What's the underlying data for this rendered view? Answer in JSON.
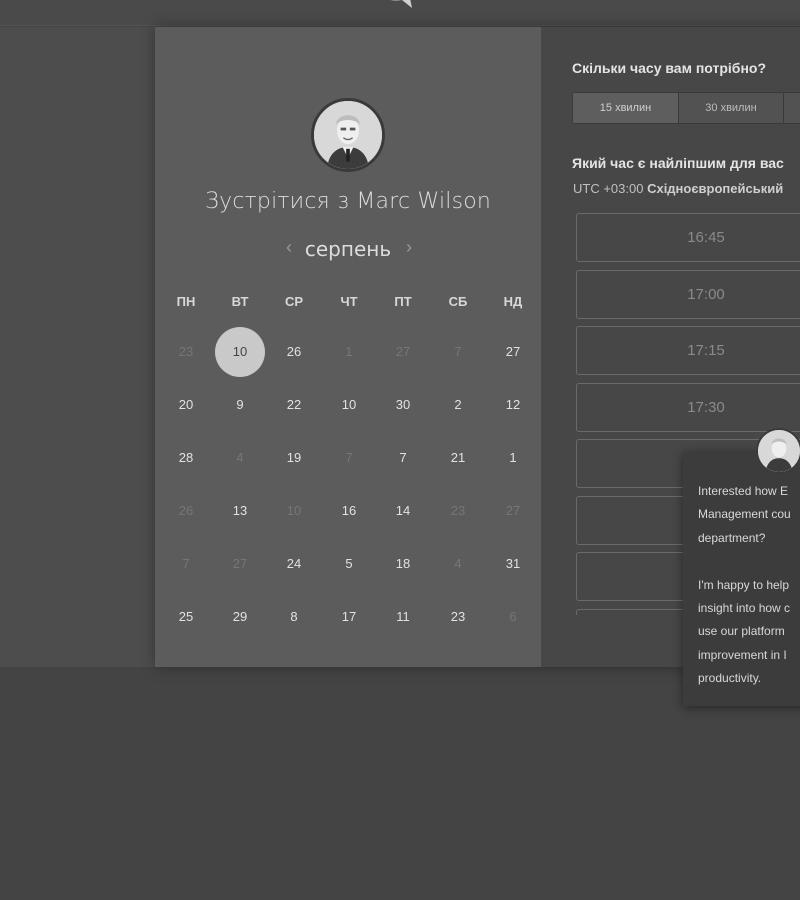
{
  "booking": {
    "meet_title": "Зустрітися з Marc Wilson",
    "month": "серпень",
    "nav_prev": "‹",
    "nav_next": "›"
  },
  "calendar": {
    "weekdays": [
      "ПН",
      "ВТ",
      "СР",
      "ЧТ",
      "ПТ",
      "СБ",
      "НД"
    ],
    "weeks": [
      [
        {
          "d": "23",
          "m": true
        },
        {
          "d": "10",
          "sel": true
        },
        {
          "d": "26"
        },
        {
          "d": "1",
          "m": true
        },
        {
          "d": "27",
          "m": true
        },
        {
          "d": "7",
          "m": true
        },
        {
          "d": "27"
        }
      ],
      [
        {
          "d": "20"
        },
        {
          "d": "9"
        },
        {
          "d": "22"
        },
        {
          "d": "10"
        },
        {
          "d": "30"
        },
        {
          "d": "2"
        },
        {
          "d": "12"
        }
      ],
      [
        {
          "d": "28"
        },
        {
          "d": "4",
          "m": true
        },
        {
          "d": "19"
        },
        {
          "d": "7",
          "m": true
        },
        {
          "d": "7"
        },
        {
          "d": "21"
        },
        {
          "d": "1"
        }
      ],
      [
        {
          "d": "26",
          "m": true
        },
        {
          "d": "13"
        },
        {
          "d": "10",
          "m": true
        },
        {
          "d": "16"
        },
        {
          "d": "14"
        },
        {
          "d": "23",
          "m": true
        },
        {
          "d": "27",
          "m": true
        }
      ],
      [
        {
          "d": "7",
          "m": true
        },
        {
          "d": "27",
          "m": true
        },
        {
          "d": "24"
        },
        {
          "d": "5"
        },
        {
          "d": "18"
        },
        {
          "d": "4",
          "m": true
        },
        {
          "d": "31"
        }
      ],
      [
        {
          "d": "25"
        },
        {
          "d": "29"
        },
        {
          "d": "8"
        },
        {
          "d": "17"
        },
        {
          "d": "11"
        },
        {
          "d": "23"
        },
        {
          "d": "6",
          "m": true
        }
      ]
    ]
  },
  "scheduler": {
    "duration_question": "Скільки часу вам потрібно?",
    "durations": [
      "15 хвилин",
      "30 хвилин",
      ""
    ],
    "time_question": "Який час є найліпшим для вас",
    "timezone_code": "UTC +03:00",
    "timezone_name": "Східноєвропейський",
    "slots": [
      "16:45",
      "17:00",
      "17:15",
      "17:30",
      "",
      "",
      "",
      ""
    ]
  },
  "chat": {
    "message": "Interested how E\nManagement cou\ndepartment?\n\nI'm happy to help\ninsight into how c\nuse our platform\nimprovement in I\nproductivity."
  },
  "colors": {
    "selected_day": "#c9c9c9",
    "left_panel": "#5c5c5c",
    "right_panel": "#474747"
  }
}
